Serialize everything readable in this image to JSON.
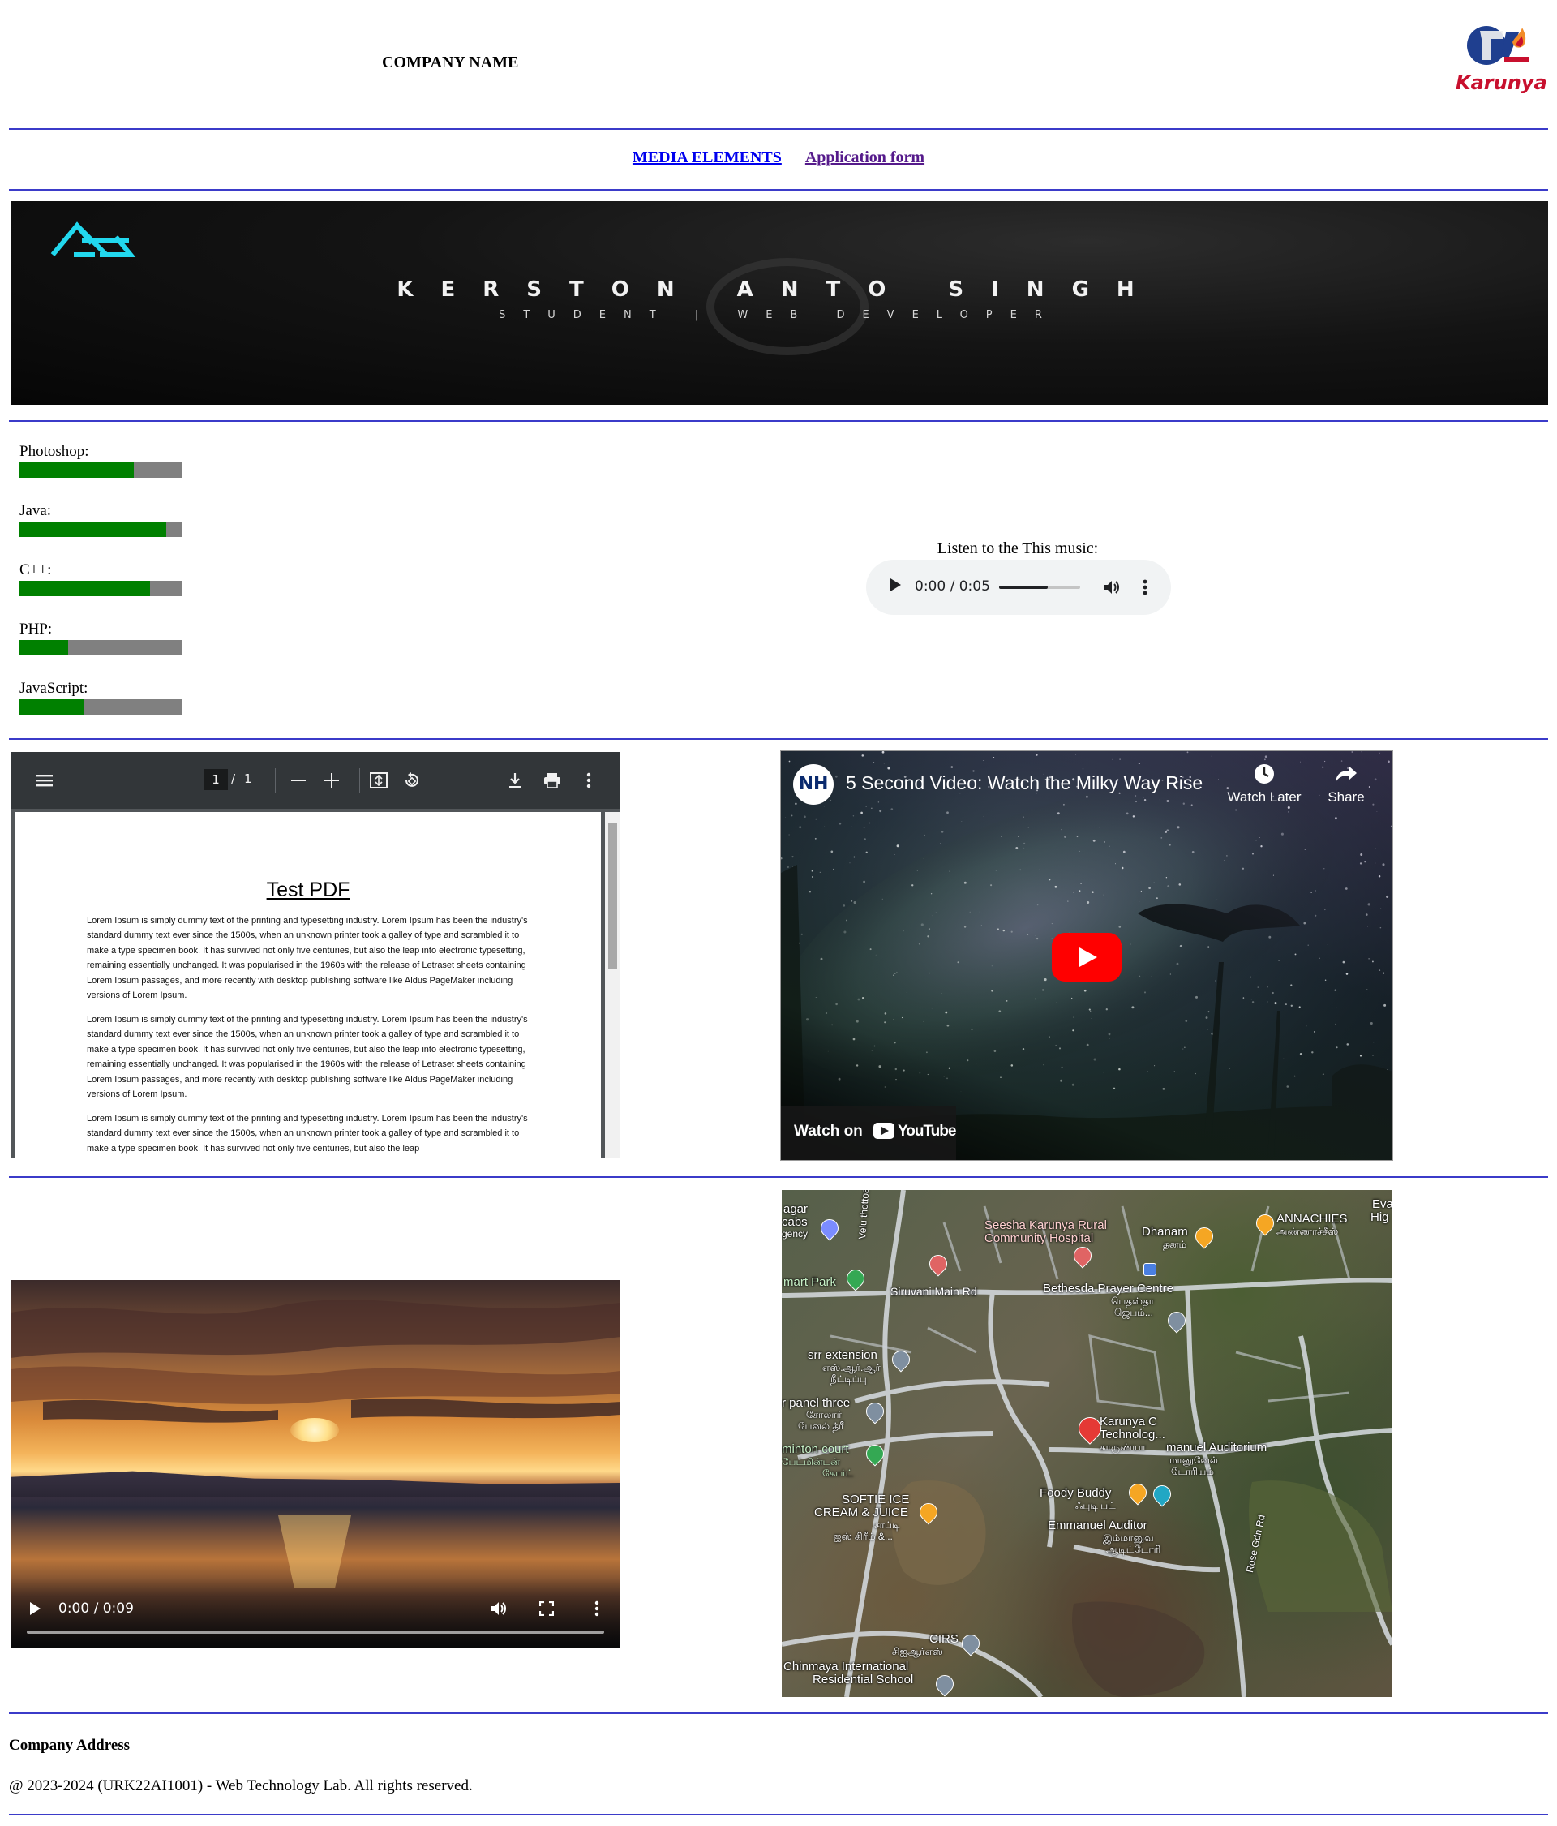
{
  "header": {
    "company_name": "COMPANY NAME",
    "logo_text": "Karunya"
  },
  "nav": {
    "links": [
      "MEDIA ELEMENTS",
      "Application form"
    ]
  },
  "banner": {
    "name": "KERSTON ANTO SINGH",
    "role": "STUDENT | WEB DEVELOPER"
  },
  "skills": [
    {
      "label": "Photoshop:",
      "level": 0.7
    },
    {
      "label": "Java:",
      "level": 0.9
    },
    {
      "label": "C++:",
      "level": 0.8
    },
    {
      "label": "PHP:",
      "level": 0.3
    },
    {
      "label": "JavaScript:",
      "level": 0.4
    }
  ],
  "audio": {
    "caption": "Listen to the This music:",
    "time": "0:00 / 0:05",
    "volume_level": 0.6
  },
  "pdf": {
    "page_current": "1",
    "page_total": "1",
    "title": "Test PDF",
    "paragraphs": [
      "Lorem Ipsum is simply dummy text of the printing and typesetting industry. Lorem Ipsum has been the industry's standard dummy text ever since the 1500s, when an unknown printer took a galley of type and scrambled it to make a type specimen book. It has survived not only five centuries, but also the leap into electronic typesetting, remaining essentially unchanged. It was popularised in the 1960s with the release of Letraset sheets containing Lorem Ipsum passages, and more recently with desktop publishing software like Aldus PageMaker including versions of Lorem Ipsum.",
      "Lorem Ipsum is simply dummy text of the printing and typesetting industry. Lorem Ipsum has been the industry's standard dummy text ever since the 1500s, when an unknown printer took a galley of type and scrambled it to make a type specimen book. It has survived not only five centuries, but also the leap into electronic typesetting, remaining essentially unchanged. It was popularised in the 1960s with the release of Letraset sheets containing Lorem Ipsum passages, and more recently with desktop publishing software like Aldus PageMaker including versions of Lorem Ipsum.",
      "Lorem Ipsum is simply dummy text of the printing and typesetting industry. Lorem Ipsum has been the industry's standard dummy text ever since the 1500s, when an unknown printer took a galley of type and scrambled it to make a type specimen book. It has survived not only five centuries, but also the leap"
    ]
  },
  "youtube": {
    "channel_badge": "NH",
    "title": "5 Second Video: Watch the Milky Way Rise",
    "watch_later": "Watch Later",
    "share": "Share",
    "watch_on": "Watch on",
    "brand": "YouTube"
  },
  "video": {
    "time": "0:00 / 0:09"
  },
  "map": {
    "labels": {
      "nagar": "agar",
      "cabs": "cabs",
      "agency": "gency",
      "velu": "Velu thottoam",
      "seesha": "Seesha  Karunya Rural",
      "hospital": "Community Hospital",
      "dhanam": "Dhanam",
      "dhanam_ta": "தனம்",
      "annachies": "ANNACHIES",
      "annachies_ta": "அண்ணாச்சீஸ்",
      "eva": "Eva",
      "hig": "Hig",
      "smart_park": "mart Park",
      "siruvani": "Siruvani Main Rd",
      "bethesda": "Bethesda Prayer Centre",
      "bethesda_ta1": "பெதஸ்தா",
      "bethesda_ta2": "ஜெபம்...",
      "srr": "srr extension",
      "srr_ta1": "எஸ்.ஆர்.ஆர்",
      "srr_ta2": "நீட்டிப்பு",
      "panel": "r panel three",
      "panel_ta1": "சோலார்",
      "panel_ta2": "பேனல் த்ரீ",
      "karunya": "Karunya C",
      "technology": "Technolog...",
      "karunya_ta": "காருண்யா",
      "auditorium": "manuel Auditorium",
      "auditorium_ta1": "மானுவேல்",
      "auditorium_ta2": "டோரியம்",
      "minton": "minton court",
      "minton_ta1": "பேட்மின்டன்",
      "minton_ta2": "கோர்ட்",
      "foody": "Foody Buddy",
      "foody_ta": "ஃபுடி பட்",
      "softie": "SOFTIE ICE",
      "cream": "CREAM & JUICE",
      "softie_ta1": "சாப்டி",
      "softie_ta2": "ஐஸ் கிரீம் &...",
      "emmanuel": "Emmanuel Auditor",
      "emmanuel_ta1": "இம்மானுவ",
      "emmanuel_ta2": "ஆடிட்டோரி",
      "rose": "Rose Gdn Rd",
      "cirs": "CIRS",
      "cirs_ta": "சிஐஆர்எஸ்",
      "chinmaya": "Chinmaya International",
      "residential": "Residential School"
    }
  },
  "footer": {
    "title": "Company Address",
    "copyright": "@ 2023-2024 (URK22AI1001) - Web Technology Lab. All rights reserved."
  }
}
